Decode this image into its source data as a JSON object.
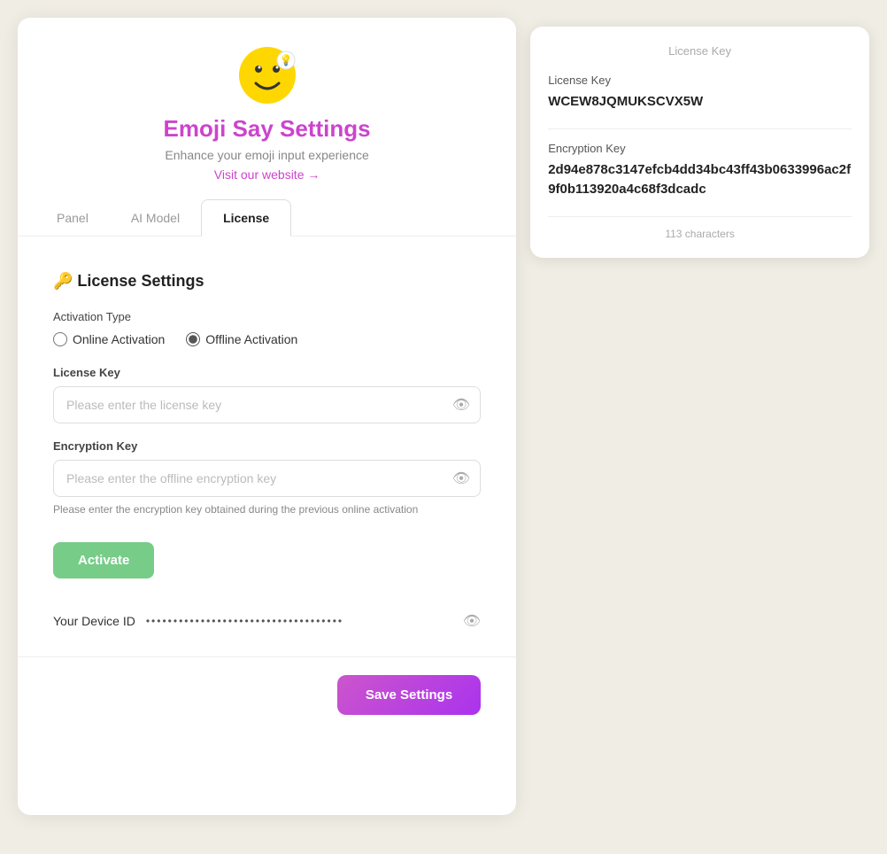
{
  "app": {
    "icon_label": "emoji-say-icon",
    "title": "Emoji Say Settings",
    "subtitle": "Enhance your emoji input experience",
    "visit_link": "Visit our website →"
  },
  "tabs": [
    {
      "id": "panel",
      "label": "Panel",
      "active": false
    },
    {
      "id": "ai-model",
      "label": "AI Model",
      "active": false
    },
    {
      "id": "license",
      "label": "License",
      "active": true
    }
  ],
  "license_settings": {
    "section_title": "🔑 License Settings",
    "activation_type_label": "Activation Type",
    "online_activation_label": "Online Activation",
    "offline_activation_label": "Offline Activation",
    "license_key_label": "License Key",
    "license_key_placeholder": "Please enter the license key",
    "encryption_key_label": "Encryption Key",
    "encryption_key_placeholder": "Please enter the offline encryption key",
    "encryption_hint": "Please enter the encryption key obtained during the previous online activation",
    "activate_button": "Activate",
    "device_id_label": "Your Device ID",
    "device_id_dots": "••••••••••••••••••••••••••••••••••••",
    "save_button": "Save Settings"
  },
  "license_card": {
    "title": "License Key",
    "license_key_name": "License Key",
    "license_key_value": "WCEW8JQMUKSCVX5W",
    "encryption_key_name": "Encryption Key",
    "encryption_key_value": "2d94e878c3147efcb4dd34bc43ff43b0633996ac2f9f0b113920a4c68f3dcadc",
    "char_count": "113 characters"
  }
}
